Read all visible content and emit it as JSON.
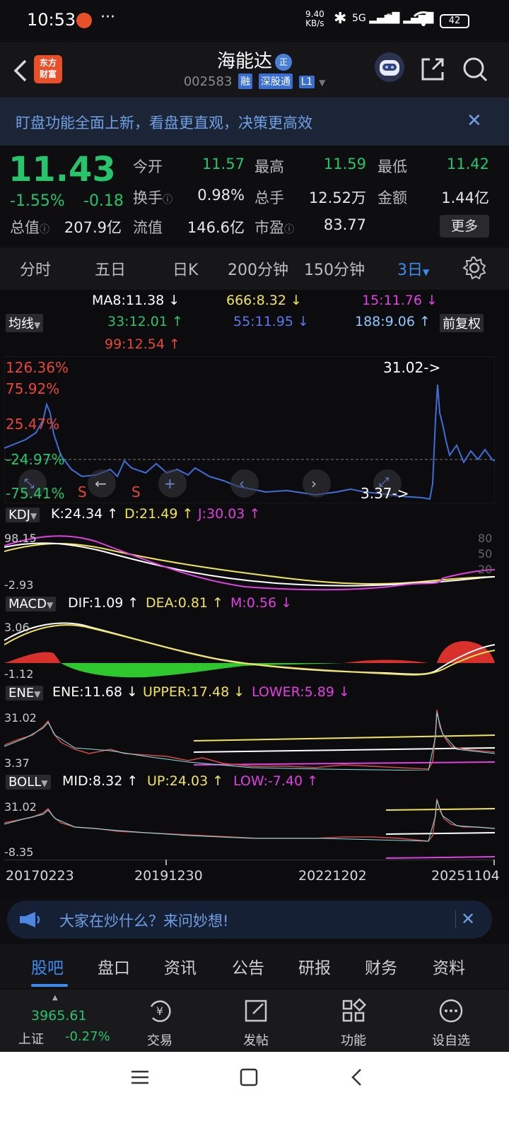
{
  "status_bar": {
    "time": "10:53",
    "more": "···",
    "net_speed_value": "9.40",
    "net_speed_unit": "KB/s",
    "signal1": "5G",
    "signal2": "5G",
    "battery": "42"
  },
  "header": {
    "back_icon": "chevron-left-icon",
    "logo_line1": "东方",
    "logo_line2": "财富",
    "stock_name": "海能达",
    "badge": "正",
    "stock_code": "002583",
    "tags": [
      "融",
      "深股通",
      "L1"
    ],
    "icons": [
      "robot-assistant-icon",
      "share-icon",
      "search-icon"
    ]
  },
  "banner": {
    "text": "盯盘功能全面上新，看盘更直观，决策更高效",
    "close": "✕"
  },
  "quote": {
    "price": "11.43",
    "change_pct": "-1.55%",
    "change": "-0.18",
    "rows": [
      [
        {
          "label": "今开",
          "value": "11.57",
          "green": true
        },
        {
          "label": "最高",
          "value": "11.59",
          "green": true
        },
        {
          "label": "最低",
          "value": "11.42",
          "green": true
        }
      ],
      [
        {
          "label": "换手",
          "value": "0.98%",
          "green": false
        },
        {
          "label": "总手",
          "value": "12.52万",
          "green": false
        },
        {
          "label": "金额",
          "value": "1.44亿",
          "green": false
        }
      ],
      [
        {
          "label": "总值",
          "value": "207.9亿",
          "green": false
        },
        {
          "label": "流值",
          "value": "146.6亿",
          "green": false
        },
        {
          "label": "市盈",
          "value": "83.77",
          "green": false
        }
      ]
    ],
    "more_button": "更多"
  },
  "periods": {
    "tabs": [
      "分时",
      "五日",
      "日K",
      "200分钟",
      "150分钟",
      "3日"
    ],
    "active_index": 5,
    "settings_icon": "gear-icon"
  },
  "chart": {
    "ma_selector": "均线",
    "adjust_button": "前复权",
    "ma_values": [
      {
        "text": "MA8:11.38 ↓",
        "color": "#ffffff"
      },
      {
        "text": "666:8.32 ↓",
        "color": "#f2e35a"
      },
      {
        "text": "15:11.76 ↓",
        "color": "#e040e0"
      },
      {
        "text": "33:12.01 ↑",
        "color": "#27c46b"
      },
      {
        "text": "55:11.95 ↓",
        "color": "#5a78f0"
      },
      {
        "text": "188:9.06 ↑",
        "color": "#8ec8ff"
      },
      {
        "text": "99:12.54 ↑",
        "color": "#e8463a"
      }
    ],
    "main_axis": [
      "126.36%",
      "75.92%",
      "25.47%",
      "-24.97%",
      "-75.41%"
    ],
    "max_label": "31.02->",
    "min_label": "3.37->",
    "sell_markers": [
      "S",
      "S"
    ],
    "kdj": {
      "name": "KDJ",
      "k": "K:24.34 ↑",
      "d": "D:21.49 ↑",
      "j": "J:30.03 ↑",
      "top": "98.15",
      "bottom": "-2.93",
      "r1": "80",
      "r2": "50",
      "r3": "20"
    },
    "macd": {
      "name": "MACD",
      "dif": "DIF:1.09 ↑",
      "dea": "DEA:0.81 ↑",
      "m": "M:0.56 ↓",
      "top": "3.06",
      "bottom": "-1.12"
    },
    "ene": {
      "name": "ENE",
      "ene": "ENE:11.68 ↓",
      "upper": "UPPER:17.48 ↓",
      "lower": "LOWER:5.89 ↓",
      "top": "31.02",
      "bottom": "3.37"
    },
    "boll": {
      "name": "BOLL",
      "mid": "MID:8.32 ↑",
      "up": "UP:24.03 ↑",
      "low": "LOW:-7.40 ↑",
      "top": "31.02",
      "bottom": "-8.35"
    },
    "dates": [
      "20170223",
      "20191230",
      "20221202",
      "20251104"
    ]
  },
  "ask": {
    "text": "大家在炒什么？来问妙想!",
    "icon": "megaphone-icon",
    "close": "✕"
  },
  "bottom_tabs": {
    "items": [
      "股吧",
      "盘口",
      "资讯",
      "公告",
      "研报",
      "财务",
      "资料"
    ],
    "active_index": 0
  },
  "toolbar": {
    "index_value": "3965.61",
    "index_name": "上证",
    "index_change": "-0.27%",
    "items": [
      {
        "label": "交易",
        "icon": "trade-icon"
      },
      {
        "label": "发帖",
        "icon": "post-edit-icon"
      },
      {
        "label": "功能",
        "icon": "grid-apps-icon"
      },
      {
        "label": "设自选",
        "icon": "more-circle-icon"
      }
    ]
  }
}
